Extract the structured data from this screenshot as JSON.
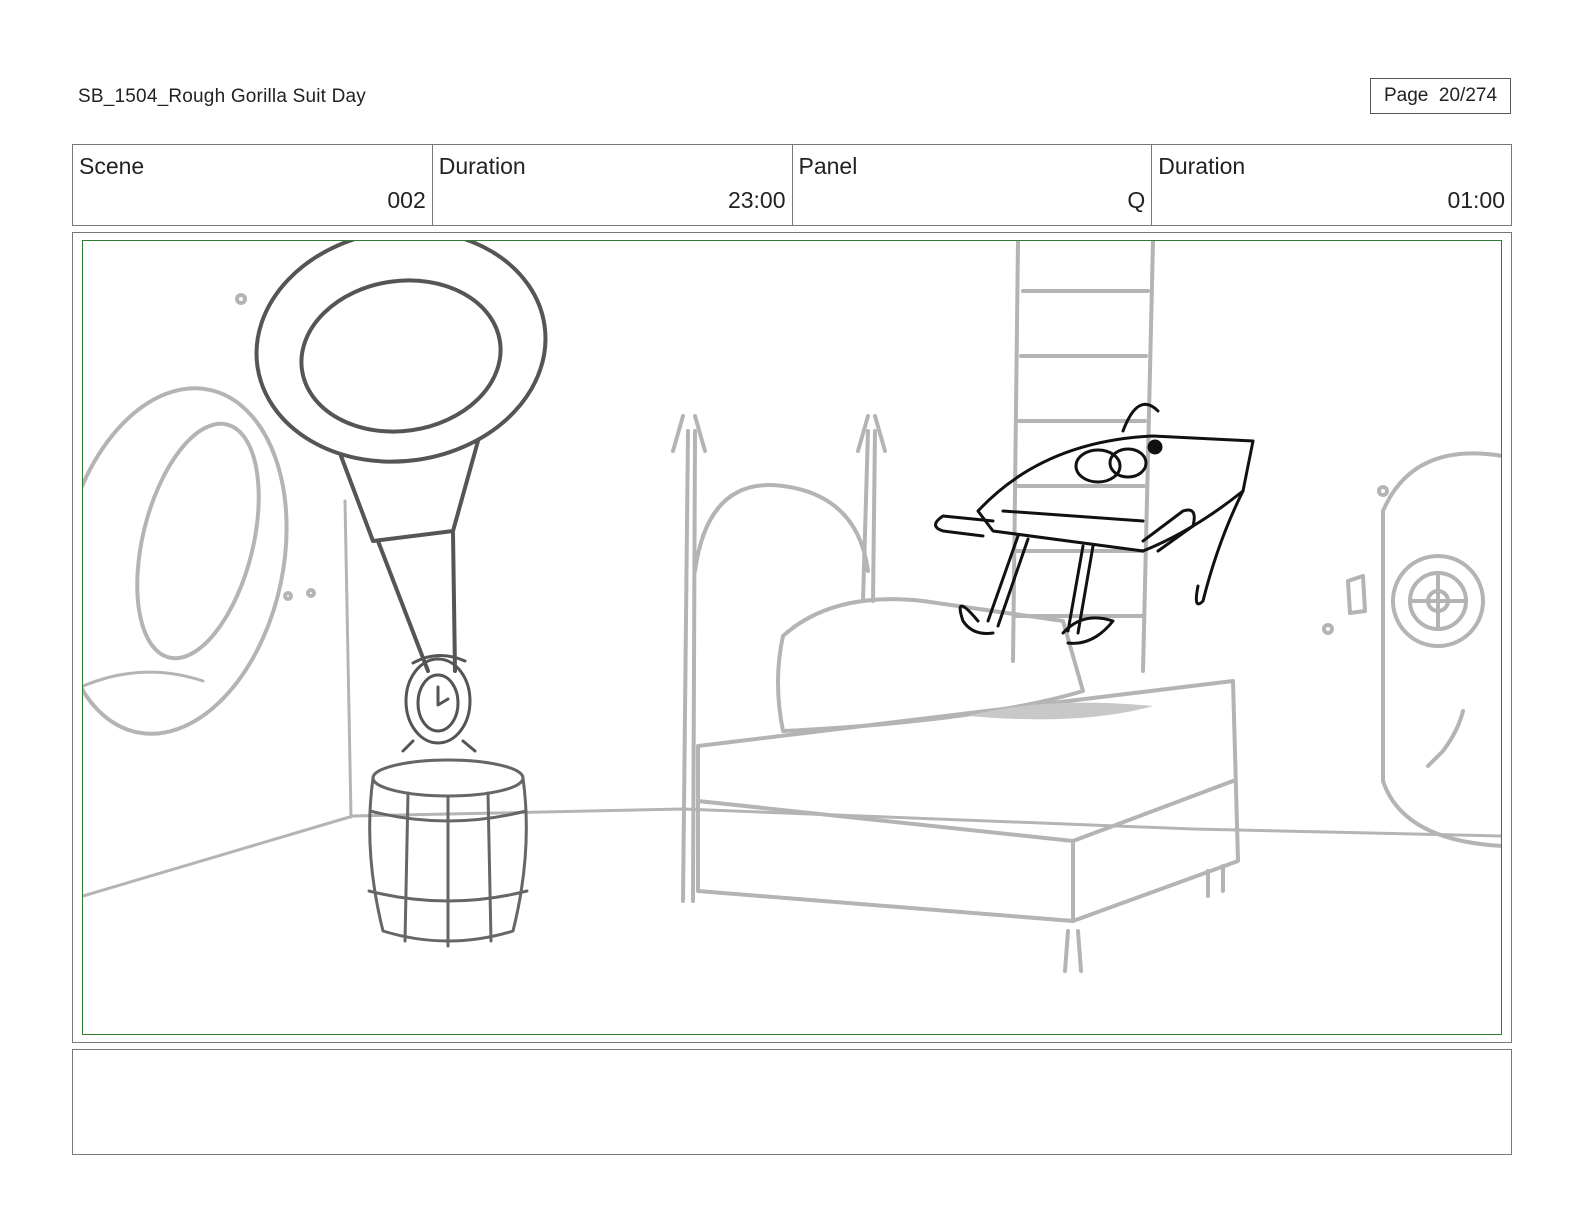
{
  "header": {
    "title": "SB_1504_Rough  Gorilla Suit Day",
    "page_label": "Page",
    "page_number": "20/274"
  },
  "info": {
    "scene_label": "Scene",
    "scene_value": "002",
    "scene_duration_label": "Duration",
    "scene_duration_value": "23:00",
    "panel_label": "Panel",
    "panel_value": "Q",
    "panel_duration_label": "Duration",
    "panel_duration_value": "01:00"
  },
  "colors": {
    "frame_border": "#777777",
    "safe_area": "#2e7d32",
    "sketch_light": "#b4b4b4",
    "sketch_dark": "#555555",
    "ink": "#111111"
  },
  "notes": {
    "text": ""
  }
}
